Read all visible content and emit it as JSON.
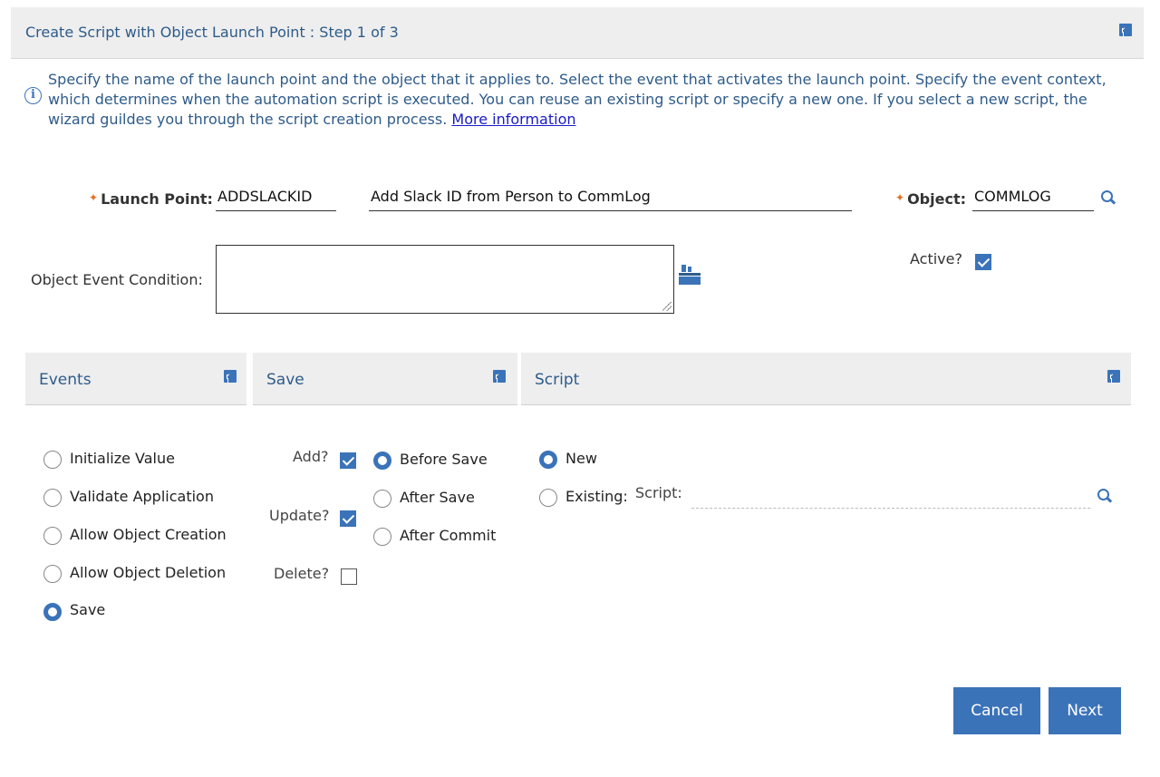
{
  "dialog": {
    "title": "Create Script with Object Launch Point : Step 1 of 3",
    "info_text": "Specify the name of the launch point and the object that it applies to. Select the event that activates the launch point. Specify the event context, which determines when the automation script is executed. You can reuse an existing script or specify a new one. If you select a new script, the wizard guildes you through the script creation process.",
    "info_link": "More information"
  },
  "form": {
    "launch_point_label": "Launch Point:",
    "launch_point_value": "ADDSLACKID",
    "description_value": "Add Slack ID from Person to CommLog",
    "object_label": "Object:",
    "object_value": "COMMLOG",
    "condition_label": "Object Event Condition:",
    "condition_value": "",
    "active_label": "Active?",
    "active_checked": true
  },
  "sections": {
    "events": {
      "title": "Events"
    },
    "save": {
      "title": "Save"
    },
    "script": {
      "title": "Script"
    }
  },
  "events": {
    "options": [
      {
        "label": "Initialize Value",
        "selected": false
      },
      {
        "label": "Validate Application",
        "selected": false
      },
      {
        "label": "Allow Object Creation",
        "selected": false
      },
      {
        "label": "Allow Object Deletion",
        "selected": false
      },
      {
        "label": "Save",
        "selected": true
      }
    ]
  },
  "save": {
    "checks": [
      {
        "label": "Add?",
        "checked": true
      },
      {
        "label": "Update?",
        "checked": true
      },
      {
        "label": "Delete?",
        "checked": false
      }
    ],
    "timing": [
      {
        "label": "Before Save",
        "selected": true
      },
      {
        "label": "After Save",
        "selected": false
      },
      {
        "label": "After Commit",
        "selected": false
      }
    ]
  },
  "script": {
    "new_label": "New",
    "existing_label": "Existing:",
    "script_label": "Script:",
    "script_value": "",
    "selected": "New"
  },
  "buttons": {
    "cancel": "Cancel",
    "next": "Next"
  },
  "colors": {
    "accent": "#3b73b9",
    "title_text": "#2e5b8a",
    "required_star": "#e67020",
    "link": "#1a1ac8"
  }
}
